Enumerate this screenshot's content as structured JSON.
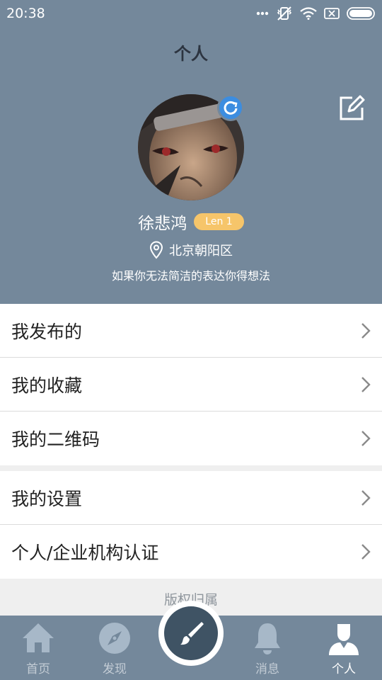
{
  "status_bar": {
    "time": "20:38"
  },
  "page_title": "个人",
  "profile": {
    "name": "徐悲鸿",
    "level": "Len 1",
    "location": "北京朝阳区",
    "bio": "如果你无法简洁的表达你得想法"
  },
  "menu_group_1": [
    {
      "label": "我发布的"
    },
    {
      "label": "我的收藏"
    },
    {
      "label": "我的二维码"
    }
  ],
  "menu_group_2": [
    {
      "label": "我的设置"
    },
    {
      "label": "个人/企业机构认证"
    }
  ],
  "copyright": "版权归属",
  "tabbar": {
    "tabs": [
      {
        "label": "首页",
        "icon": "home-icon"
      },
      {
        "label": "发现",
        "icon": "compass-icon"
      },
      {
        "label": "消息",
        "icon": "bell-icon"
      },
      {
        "label": "个人",
        "icon": "person-icon",
        "active": true
      }
    ],
    "center_icon": "brush-icon"
  },
  "colors": {
    "header_bg": "#74889b",
    "level_badge": "#f6c56a",
    "avatar_badge": "#3c8de0"
  }
}
